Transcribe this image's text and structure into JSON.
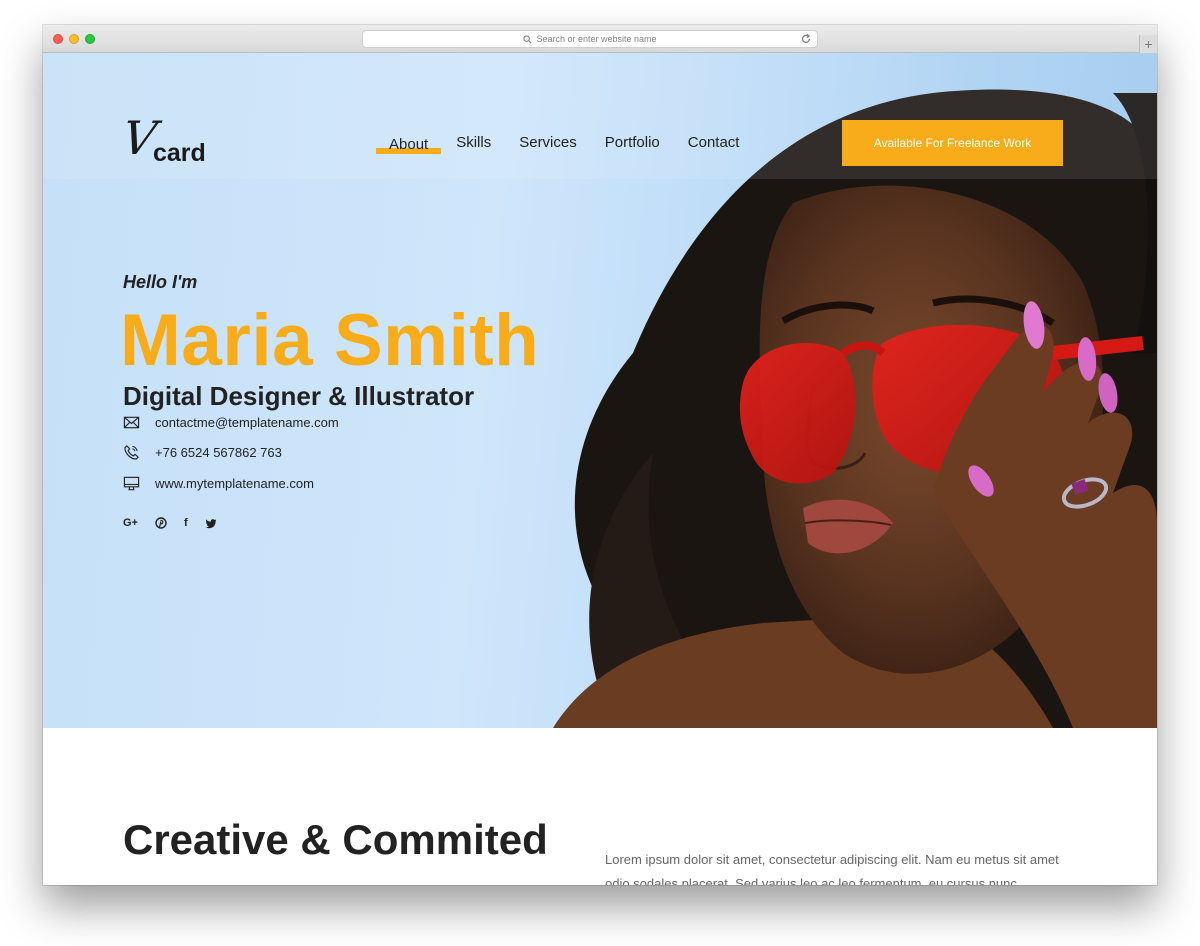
{
  "browser": {
    "url_placeholder": "Search or enter website name",
    "new_tab_label": "+"
  },
  "header": {
    "logo_letter": "V",
    "logo_word": "card",
    "nav": [
      {
        "label": "About",
        "active": true
      },
      {
        "label": "Skills",
        "active": false
      },
      {
        "label": "Services",
        "active": false
      },
      {
        "label": "Portfolio",
        "active": false
      },
      {
        "label": "Contact",
        "active": false
      }
    ],
    "cta_label": "Available For Freelance Work"
  },
  "hero": {
    "greeting": "Hello I'm",
    "name": "Maria Smith",
    "role": "Digital Designer & Illustrator",
    "contacts": {
      "email": "contactme@templatename.com",
      "phone": "+76 6524 567862 763",
      "website": "www.mytemplatename.com"
    },
    "social": [
      {
        "icon": "google-plus-icon",
        "glyph": "G+"
      },
      {
        "icon": "pinterest-icon"
      },
      {
        "icon": "facebook-icon",
        "glyph": "f"
      },
      {
        "icon": "twitter-icon"
      }
    ]
  },
  "about": {
    "title": "Creative & Commited",
    "text": "Lorem ipsum dolor sit amet, consectetur adipiscing elit. Nam eu metus sit amet odio sodales placerat. Sed varius leo ac leo fermentum, eu cursus nunc"
  },
  "colors": {
    "accent": "#f9ac19",
    "text_dark": "#222222",
    "sky": "#c5e0f8"
  }
}
